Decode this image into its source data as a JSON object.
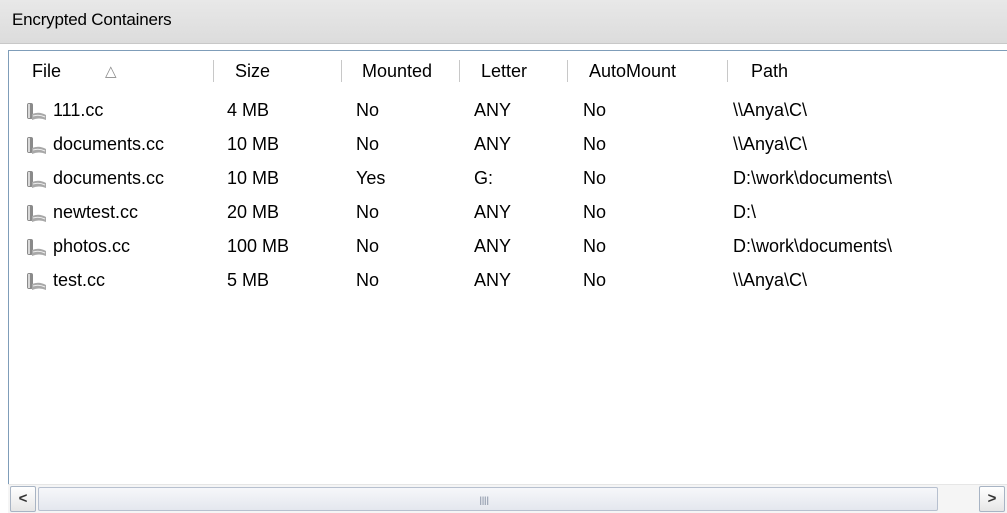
{
  "panel": {
    "title": "Encrypted Containers"
  },
  "columns": [
    {
      "label": "File",
      "sort": "ascending"
    },
    {
      "label": "Size"
    },
    {
      "label": "Mounted"
    },
    {
      "label": "Letter"
    },
    {
      "label": "AutoMount"
    },
    {
      "label": "Path"
    }
  ],
  "sort_glyph": "△",
  "rows": [
    {
      "file": "111.cc",
      "size": "4 MB",
      "mounted": "No",
      "letter": "ANY",
      "automount": "No",
      "path": "\\\\Anya\\C\\"
    },
    {
      "file": "documents.cc",
      "size": "10 MB",
      "mounted": "No",
      "letter": "ANY",
      "automount": "No",
      "path": "\\\\Anya\\C\\"
    },
    {
      "file": "documents.cc",
      "size": "10 MB",
      "mounted": "Yes",
      "letter": "G:",
      "automount": "No",
      "path": "D:\\work\\documents\\"
    },
    {
      "file": "newtest.cc",
      "size": "20 MB",
      "mounted": "No",
      "letter": "ANY",
      "automount": "No",
      "path": "D:\\"
    },
    {
      "file": "photos.cc",
      "size": "100 MB",
      "mounted": "No",
      "letter": "ANY",
      "automount": "No",
      "path": "D:\\work\\documents\\"
    },
    {
      "file": "test.cc",
      "size": "5 MB",
      "mounted": "No",
      "letter": "ANY",
      "automount": "No",
      "path": "\\\\Anya\\C\\"
    }
  ],
  "scrollbar": {
    "left_arrow": "<",
    "right_arrow": ">",
    "grip": "IIII"
  },
  "icons": {
    "row_icon": "container-icon"
  }
}
